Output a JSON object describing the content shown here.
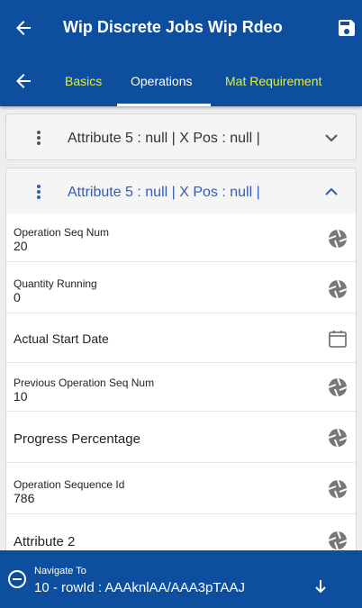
{
  "header": {
    "title": "Wip Discrete Jobs Wip Rdeo"
  },
  "tabs": [
    {
      "label": "Basics"
    },
    {
      "label": "Operations"
    },
    {
      "label": "Mat Requirement"
    }
  ],
  "cards": [
    {
      "title": "Attribute 5 : null | X Pos  : null |"
    },
    {
      "title": "Attribute 5 : null | X Pos  : null |"
    }
  ],
  "fields": [
    {
      "label": "Operation Seq Num",
      "value": "20"
    },
    {
      "label": "Quantity Running",
      "value": "0"
    },
    {
      "label": "Actual Start Date"
    },
    {
      "label": "Previous Operation Seq Num",
      "value": "10"
    },
    {
      "label": "Progress Percentage"
    },
    {
      "label": "Operation Sequence Id",
      "value": "786"
    },
    {
      "label": "Attribute 2"
    }
  ],
  "footer": {
    "label": "Navigate To",
    "value": "10 - rowId : AAAknlAA/AAA3pTAAJ"
  },
  "colors": {
    "primary": "#0d4f9e",
    "tab_inactive": "#e3ee3b",
    "card_title_active": "#2f5dbd",
    "icon_gray": "#777777"
  },
  "icons": [
    "back-arrow-icon",
    "save-icon",
    "kebab-icon",
    "chevron-down-icon",
    "chevron-up-icon",
    "aperture-icon",
    "calendar-icon",
    "minus-circle-icon",
    "arrow-down-icon"
  ]
}
